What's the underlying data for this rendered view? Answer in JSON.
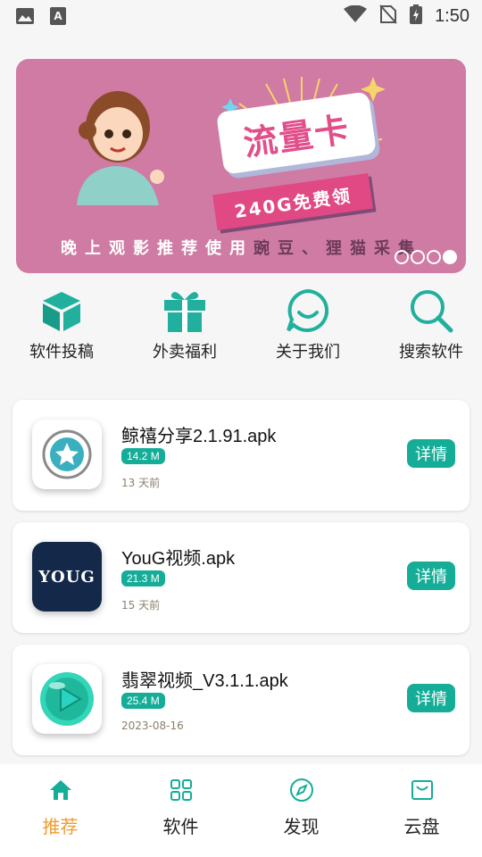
{
  "status_bar": {
    "time": "1:50"
  },
  "banner": {
    "title": "流量卡",
    "subtitle": "240G免费领",
    "caption_prefix": "晚上观影推荐使用",
    "caption_highlight": "豌豆、狸猫采集",
    "page_count": 4,
    "active_page": 4,
    "colors": {
      "background": "#cf7ba4",
      "accent": "#e04983"
    }
  },
  "quick_menu": [
    {
      "label": "软件投稿",
      "icon": "cube-icon"
    },
    {
      "label": "外卖福利",
      "icon": "gift-icon"
    },
    {
      "label": "关于我们",
      "icon": "chat-smile-icon"
    },
    {
      "label": "搜索软件",
      "icon": "search-icon"
    }
  ],
  "apps": [
    {
      "name": "鲸禧分享2.1.91.apk",
      "size": "14.2 M",
      "time": "13 天前",
      "detail_label": "详情",
      "icon": "star-badge-icon"
    },
    {
      "name": "YouG视频.apk",
      "size": "21.3 M",
      "time": "15 天前",
      "detail_label": "详情",
      "icon": "youg-logo-icon",
      "icon_text": "YOUG"
    },
    {
      "name": "翡翠视频_V3.1.1.apk",
      "size": "25.4 M",
      "time": "2023-08-16",
      "detail_label": "详情",
      "icon": "play-bubble-icon"
    }
  ],
  "bottom_nav": [
    {
      "label": "推荐",
      "icon": "home-icon",
      "active": true
    },
    {
      "label": "软件",
      "icon": "grid-icon",
      "active": false
    },
    {
      "label": "发现",
      "icon": "compass-icon",
      "active": false
    },
    {
      "label": "云盘",
      "icon": "inbox-icon",
      "active": false
    }
  ],
  "colors": {
    "accent": "#15ad98",
    "active_nav": "#f39a2d",
    "page_bg": "#f6f6f6"
  }
}
